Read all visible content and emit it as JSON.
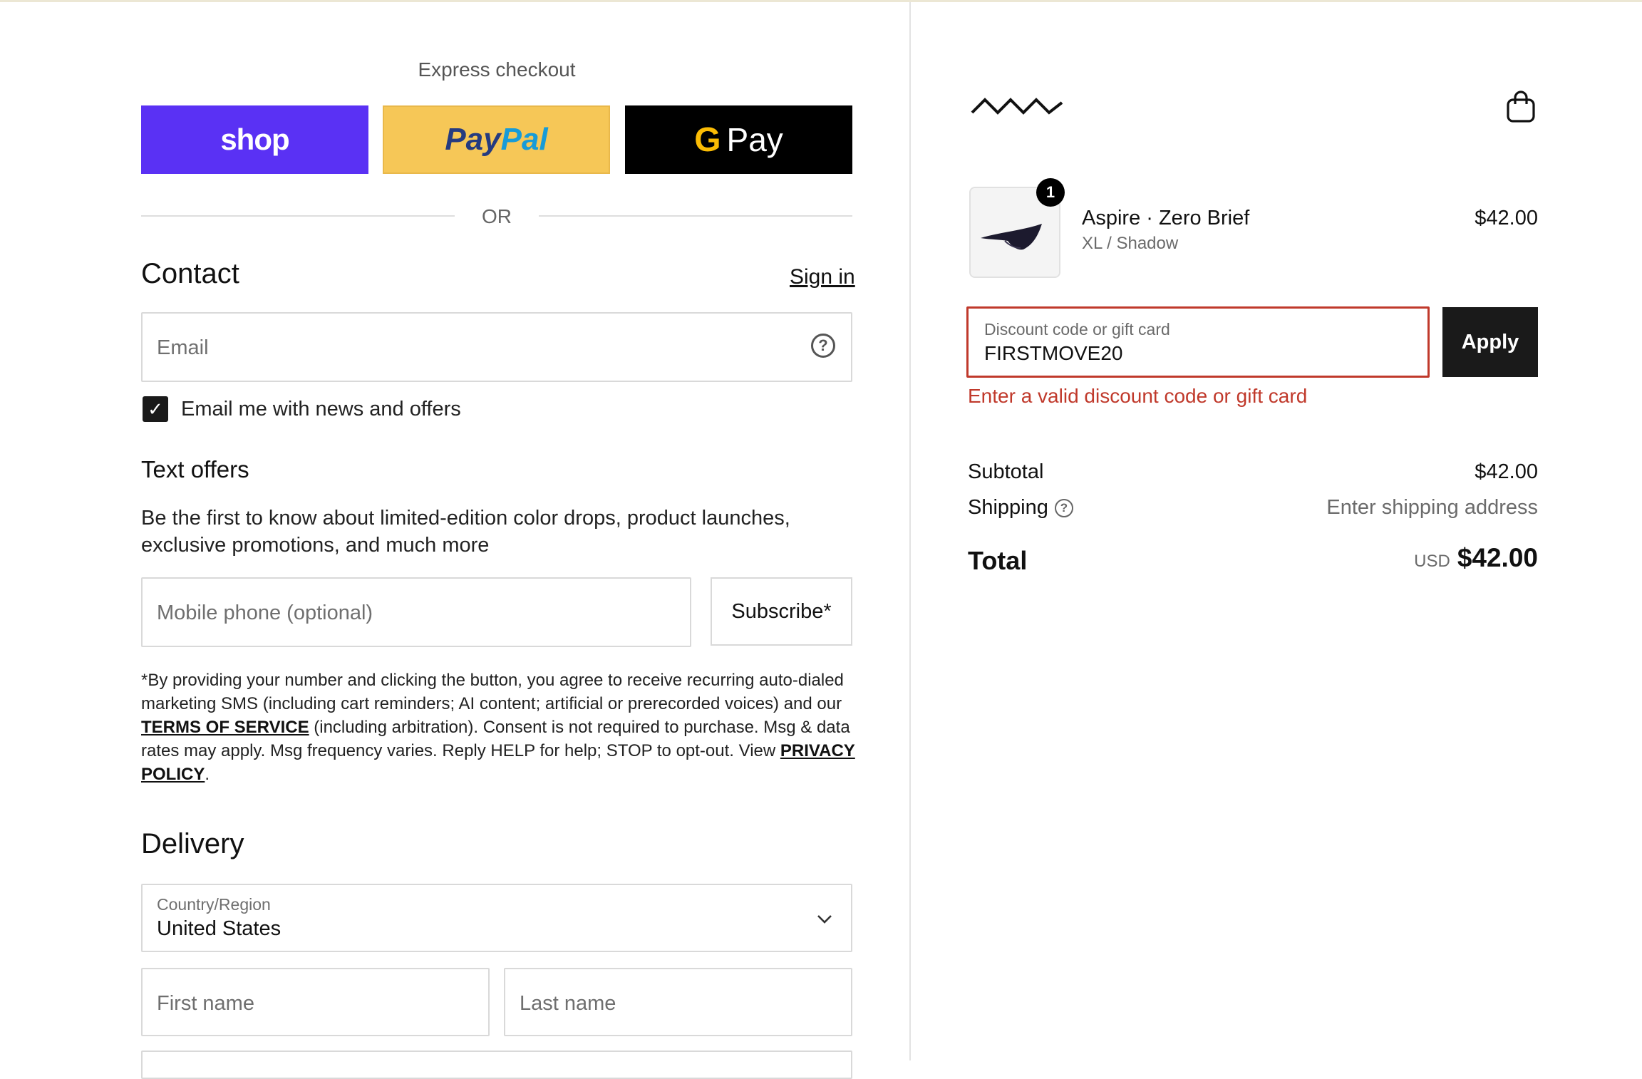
{
  "express": {
    "title": "Express checkout",
    "shop_label": "shop",
    "paypal_part1": "Pay",
    "paypal_part2": "Pal",
    "gpay_g": "G",
    "gpay_label": "Pay",
    "or_text": "OR"
  },
  "contact": {
    "heading": "Contact",
    "sign_in": "Sign in",
    "email_placeholder": "Email",
    "help_icon": "question-circle",
    "newsletter_checked": true,
    "newsletter_label": "Email me with news and offers"
  },
  "text_offers": {
    "heading": "Text offers",
    "description": "Be the first to know about limited-edition color drops, product launches, exclusive promotions, and much more",
    "phone_placeholder": "Mobile phone (optional)",
    "subscribe_label": "Subscribe*",
    "fine_print_1": "*By providing your number and clicking the button, you agree to receive recurring auto-dialed marketing SMS (including cart reminders; AI content; artificial or prerecorded voices) and our ",
    "terms_link": "TERMS OF SERVICE",
    "fine_print_2": " (including arbitration). Consent is not required to purchase. Msg & data rates may apply. Msg frequency varies. Reply HELP for help; STOP to opt-out. View ",
    "privacy_link": "PRIVACY POLICY",
    "fine_print_3": "."
  },
  "delivery": {
    "heading": "Delivery",
    "country_label": "Country/Region",
    "country_value": "United States",
    "first_name_placeholder": "First name",
    "last_name_placeholder": "Last name"
  },
  "order": {
    "quantity": "1",
    "product_name": "Aspire · Zero Brief",
    "variant": "XL / Shadow",
    "price": "$42.00",
    "discount_label": "Discount code or gift card",
    "discount_value": "FIRSTMOVE20",
    "apply_label": "Apply",
    "discount_error": "Enter a valid discount code or gift card",
    "subtotal_label": "Subtotal",
    "subtotal_value": "$42.00",
    "shipping_label": "Shipping",
    "shipping_value": "Enter shipping address",
    "total_label": "Total",
    "currency": "USD",
    "total_value": "$42.00"
  },
  "colors": {
    "shop_pay": "#5a31f4",
    "paypal": "#f6c757",
    "error": "#c0392b",
    "primary_button": "#1a1a1a"
  },
  "icons": [
    "wave-logo-icon",
    "shopping-bag-icon",
    "question-circle-icon",
    "checkmark-icon",
    "chevron-down-icon"
  ]
}
